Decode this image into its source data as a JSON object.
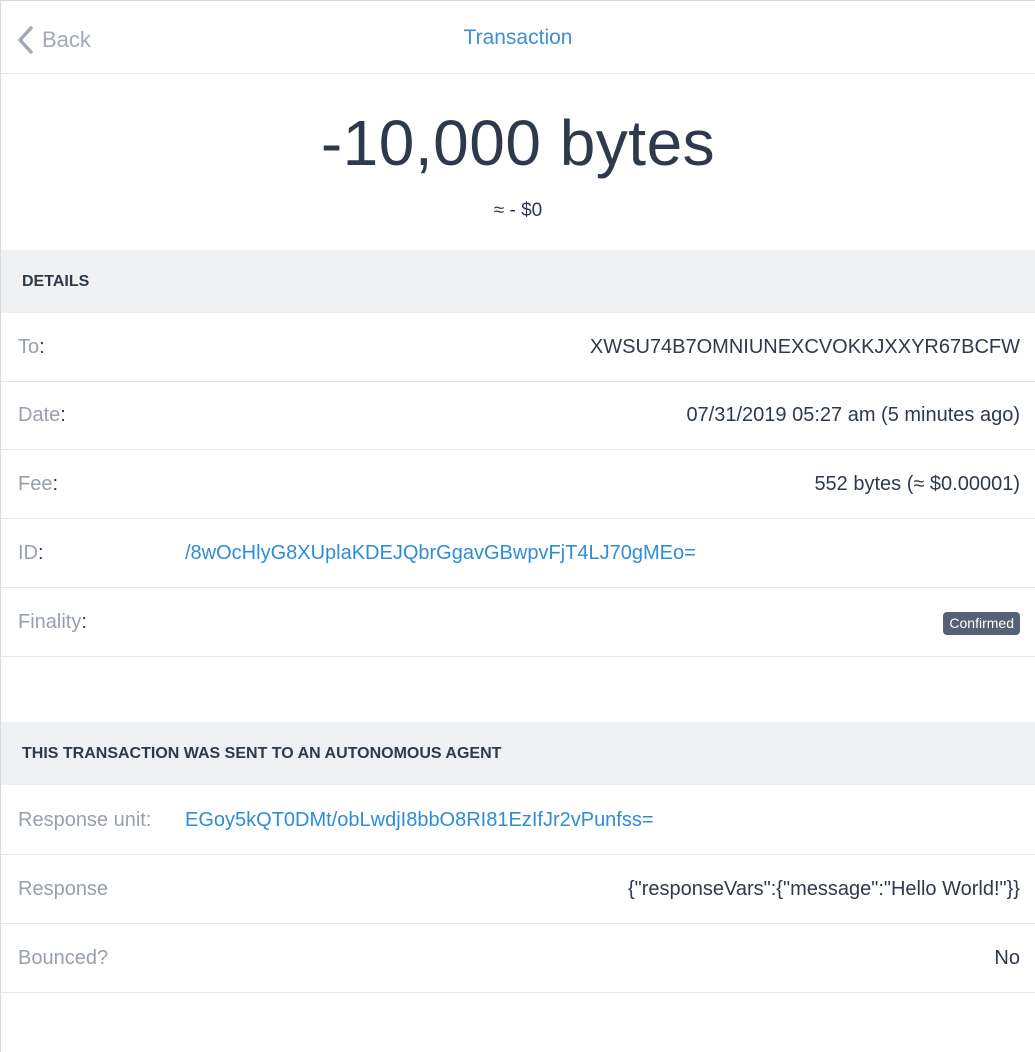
{
  "header": {
    "back_label": "Back",
    "title": "Transaction"
  },
  "amount": {
    "value": "-10,000 bytes",
    "fiat": "≈ - $0"
  },
  "details": {
    "section_title": "DETAILS",
    "to_label": "To",
    "to_value": "XWSU74B7OMNIUNEXCVOKKJXXYR67BCFW",
    "date_label": "Date",
    "date_value": "07/31/2019 05:27 am (5 minutes ago)",
    "fee_label": "Fee",
    "fee_value": "552 bytes (≈ $0.00001)",
    "id_label": "ID",
    "id_value": "/8wOcHlyG8XUplaKDEJQbrGgavGBwpvFjT4LJ70gMEo=",
    "finality_label": "Finality",
    "finality_value": "Confirmed"
  },
  "agent": {
    "section_title": "THIS TRANSACTION WAS SENT TO AN AUTONOMOUS AGENT",
    "response_unit_label": "Response unit:",
    "response_unit_value": "EGoy5kQT0DMt/obLwdjI8bbO8RI81EzIfJr2vPunfss=",
    "response_label": "Response",
    "response_value": "{\"responseVars\":{\"message\":\"Hello World!\"}}",
    "bounced_label": "Bounced?",
    "bounced_value": "No"
  },
  "colors": {
    "accent": "#3f8fd1",
    "link": "#2d8dd8",
    "text": "#2e3a4b",
    "muted": "#98a0aa",
    "section_bg": "#eff1f3",
    "badge_bg": "#556275"
  },
  "icons": {
    "back": "chevron-left-icon"
  }
}
